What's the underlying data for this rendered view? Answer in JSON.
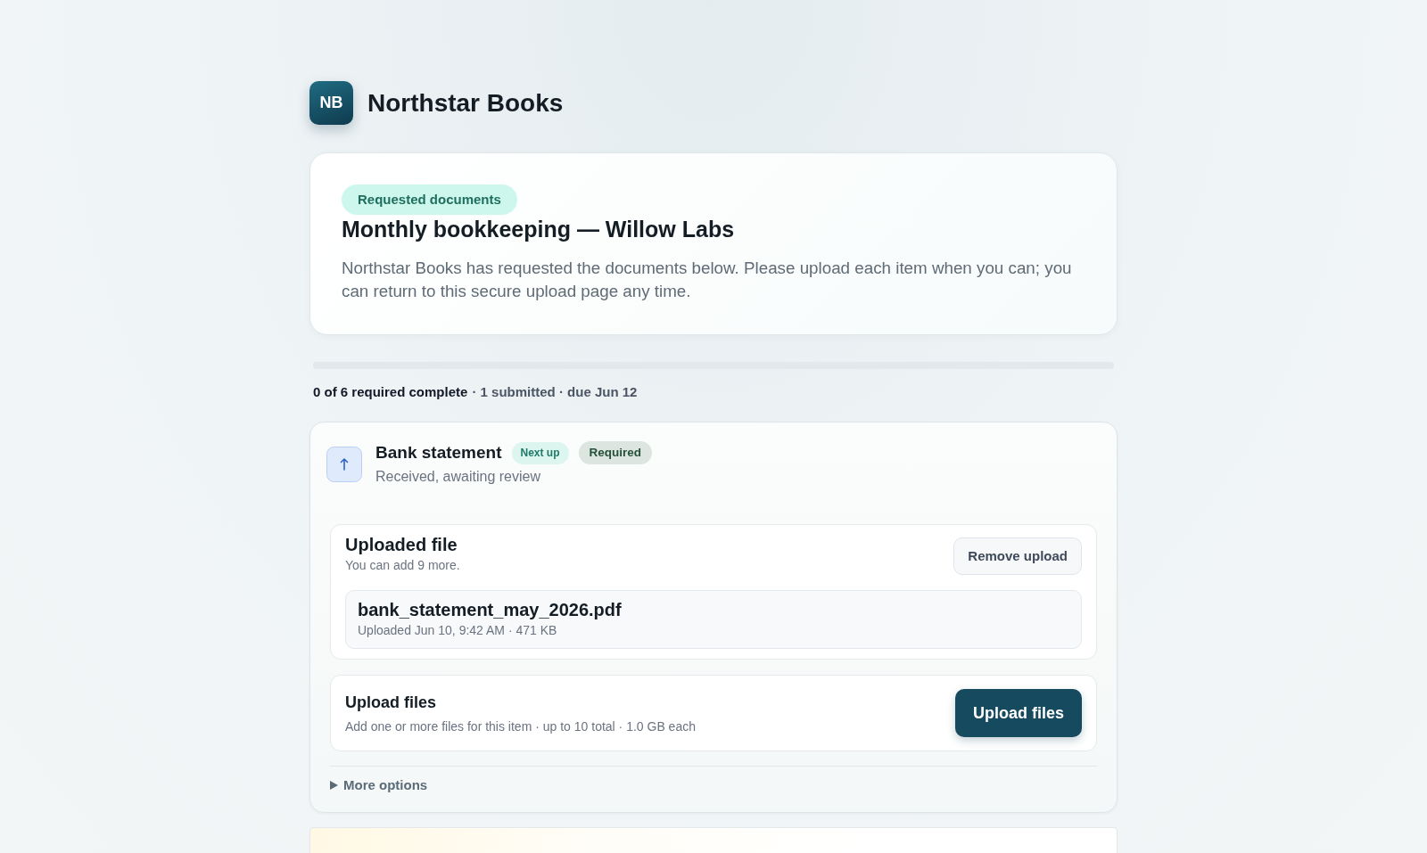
{
  "brand": {
    "logo_text": "NB",
    "name": "Northstar Books"
  },
  "intro": {
    "badge": "Requested documents",
    "title": "Monthly bookkeeping — Willow Labs",
    "description": "Northstar Books has requested the documents below. Please upload each item when you can; you can return to this secure upload page any time."
  },
  "progress": {
    "level": 0,
    "summary": "0 of 6 required complete",
    "details": "· 1 submitted · due Jun 12"
  },
  "items": [
    {
      "title": "Bank statement",
      "expanded": true,
      "badges": [
        {
          "label": "Next up",
          "kind": "next"
        },
        {
          "label": "Required",
          "kind": "required"
        }
      ],
      "status": "Received, awaiting review",
      "uploaded": {
        "title": "Uploaded file",
        "remaining": "You can add 9 more.",
        "remove_button": "Remove upload",
        "files": [
          {
            "name": "bank_statement_may_2026.pdf",
            "meta": "Uploaded Jun 10, 9:42 AM · 471 KB"
          }
        ]
      },
      "upload": {
        "title": "Upload files",
        "hint": "Add one or more files for this item · up to 10 total · 1.0 GB each",
        "button": "Upload files"
      },
      "more_options": {
        "label": "More options",
        "expanded": false
      }
    }
  ]
}
